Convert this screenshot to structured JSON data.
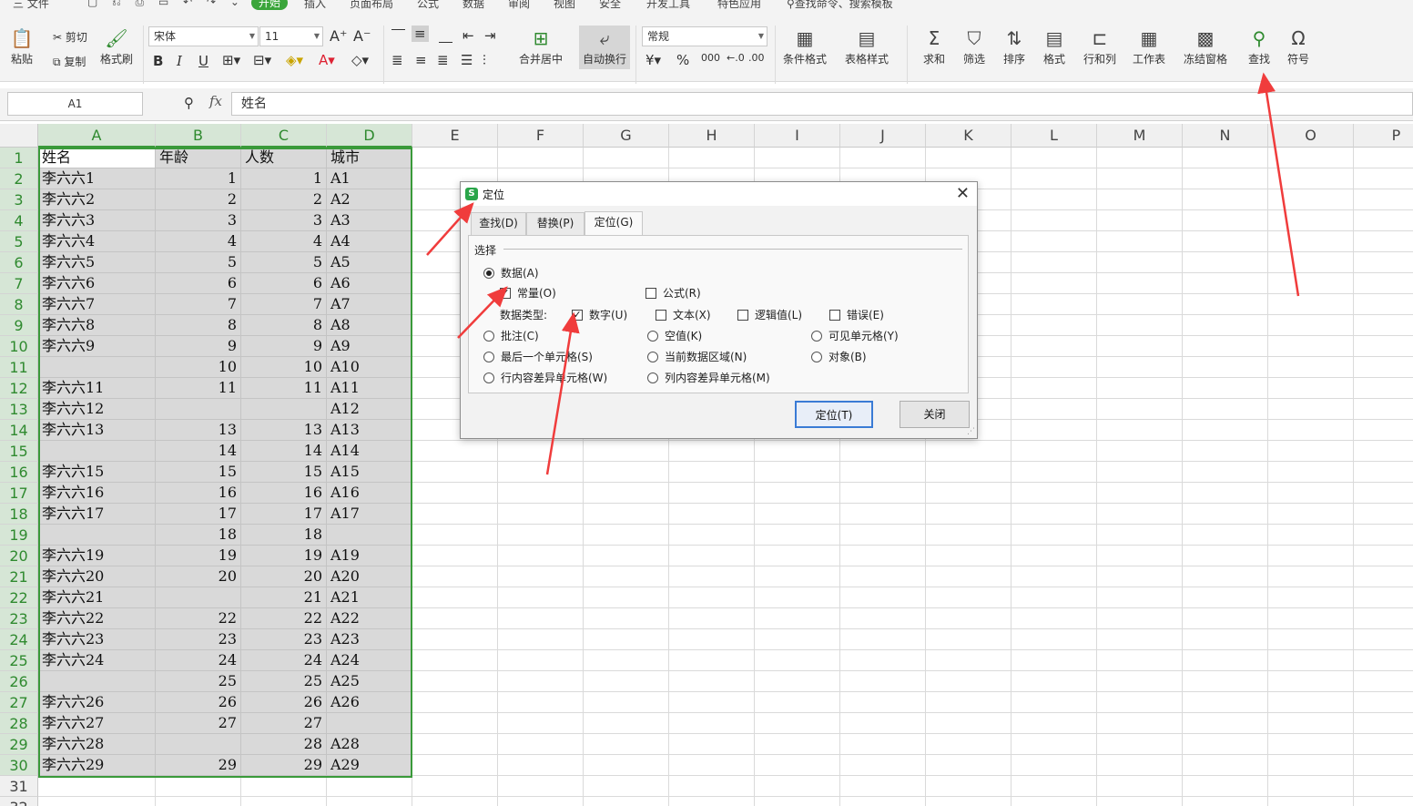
{
  "menu": {
    "items": [
      "三 文件",
      "开始",
      "插入",
      "页面布局",
      "公式",
      "数据",
      "审阅",
      "视图",
      "安全",
      "开发工具",
      "特色应用"
    ],
    "search": "查找命令、搜索模板"
  },
  "ribbon": {
    "paste": "粘贴",
    "cut": "剪切",
    "copy": "复制",
    "format_painter": "格式刷",
    "font_name": "宋体",
    "font_size": "11",
    "merge_center": "合并居中",
    "wrap_text": "自动换行",
    "number_format": "常规",
    "cond_format": "条件格式",
    "table_style": "表格样式",
    "sum": "求和",
    "filter": "筛选",
    "sort": "排序",
    "format": "格式",
    "row_col": "行和列",
    "worksheet": "工作表",
    "freeze": "冻结窗格",
    "find": "查找",
    "symbol": "符号"
  },
  "formula_bar": {
    "name_box": "A1",
    "fx": "fx",
    "value": "姓名"
  },
  "sheet": {
    "columns": [
      "A",
      "B",
      "C",
      "D",
      "E",
      "F",
      "G",
      "H",
      "I",
      "J",
      "K",
      "L",
      "M",
      "N",
      "O",
      "P"
    ],
    "rows": [
      [
        "姓名",
        "年龄",
        "人数",
        "城市"
      ],
      [
        "李六六1",
        "1",
        "1",
        "A1"
      ],
      [
        "李六六2",
        "2",
        "2",
        "A2"
      ],
      [
        "李六六3",
        "3",
        "3",
        "A3"
      ],
      [
        "李六六4",
        "4",
        "4",
        "A4"
      ],
      [
        "李六六5",
        "5",
        "5",
        "A5"
      ],
      [
        "李六六6",
        "6",
        "6",
        "A6"
      ],
      [
        "李六六7",
        "7",
        "7",
        "A7"
      ],
      [
        "李六六8",
        "8",
        "8",
        "A8"
      ],
      [
        "李六六9",
        "9",
        "9",
        "A9"
      ],
      [
        "",
        "10",
        "10",
        "A10"
      ],
      [
        "李六六11",
        "11",
        "11",
        "A11"
      ],
      [
        "李六六12",
        "",
        "",
        "A12"
      ],
      [
        "李六六13",
        "13",
        "13",
        "A13"
      ],
      [
        "",
        "14",
        "14",
        "A14"
      ],
      [
        "李六六15",
        "15",
        "15",
        "A15"
      ],
      [
        "李六六16",
        "16",
        "16",
        "A16"
      ],
      [
        "李六六17",
        "17",
        "17",
        "A17"
      ],
      [
        "",
        "18",
        "18",
        ""
      ],
      [
        "李六六19",
        "19",
        "19",
        "A19"
      ],
      [
        "李六六20",
        "20",
        "20",
        "A20"
      ],
      [
        "李六六21",
        "",
        "21",
        "A21"
      ],
      [
        "李六六22",
        "22",
        "22",
        "A22"
      ],
      [
        "李六六23",
        "23",
        "23",
        "A23"
      ],
      [
        "李六六24",
        "24",
        "24",
        "A24"
      ],
      [
        "",
        "25",
        "25",
        "A25"
      ],
      [
        "李六六26",
        "26",
        "26",
        "A26"
      ],
      [
        "李六六27",
        "27",
        "27",
        ""
      ],
      [
        "李六六28",
        "",
        "28",
        "A28"
      ],
      [
        "李六六29",
        "29",
        "29",
        "A29"
      ],
      [
        "",
        "",
        "",
        ""
      ]
    ]
  },
  "dialog": {
    "title": "定位",
    "tabs": [
      "查找(D)",
      "替换(P)",
      "定位(G)"
    ],
    "group": "选择",
    "data": "数据(A)",
    "constant": "常量(O)",
    "formula": "公式(R)",
    "data_type_label": "数据类型:",
    "number": "数字(U)",
    "text": "文本(X)",
    "logical": "逻辑值(L)",
    "error": "错误(E)",
    "comment": "批注(C)",
    "blank": "空值(K)",
    "visible": "可见单元格(Y)",
    "last_cell": "最后一个单元格(S)",
    "current_region": "当前数据区域(N)",
    "object": "对象(B)",
    "row_diff": "行内容差异单元格(W)",
    "col_diff": "列内容差异单元格(M)",
    "locate_btn": "定位(T)",
    "close_btn": "关闭"
  },
  "colors": {
    "accent": "#3a9a3a",
    "arrow": "#f03c3c"
  }
}
